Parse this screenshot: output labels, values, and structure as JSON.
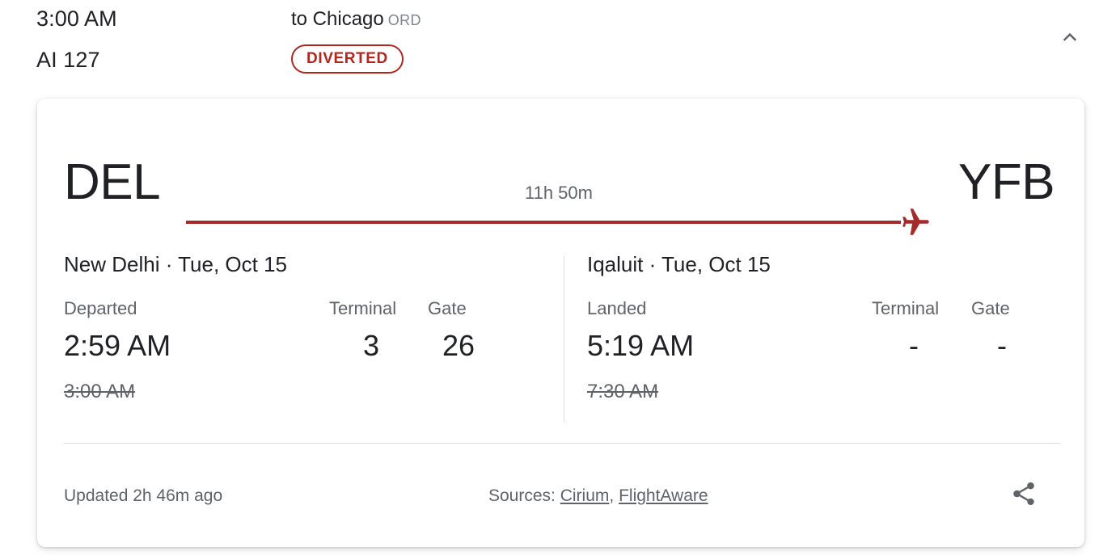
{
  "header": {
    "scheduled_time": "3:00 AM",
    "flight_number": "AI 127",
    "destination_prefix": "to Chicago",
    "destination_code": "ORD",
    "status_badge": "DIVERTED",
    "collapse_icon": "chevron-up-icon"
  },
  "route": {
    "origin_code": "DEL",
    "destination_code": "YFB",
    "duration": "11h 50m",
    "plane_icon": "airplane-icon",
    "line_color": "#a52a2a"
  },
  "departure": {
    "city_and_date": "New Delhi · Tue, Oct 15",
    "status_label": "Departed",
    "status_time": "2:59 AM",
    "scheduled_time": "3:00 AM",
    "terminal_label": "Terminal",
    "terminal_value": "3",
    "gate_label": "Gate",
    "gate_value": "26"
  },
  "arrival": {
    "city_and_date": "Iqaluit · Tue, Oct 15",
    "status_label": "Landed",
    "status_time": "5:19 AM",
    "scheduled_time": "7:30 AM",
    "terminal_label": "Terminal",
    "terminal_value": "-",
    "gate_label": "Gate",
    "gate_value": "-"
  },
  "footer": {
    "updated": "Updated 2h 46m ago",
    "sources_label": "Sources:",
    "source_1": "Cirium",
    "sources_separator": ",",
    "source_2": "FlightAware",
    "share_icon": "share-icon"
  },
  "colors": {
    "status_red": "#b3261e",
    "route_red": "#a52a2a",
    "text_primary": "#202124",
    "text_secondary": "#5f6368",
    "divider": "#dadce0"
  }
}
